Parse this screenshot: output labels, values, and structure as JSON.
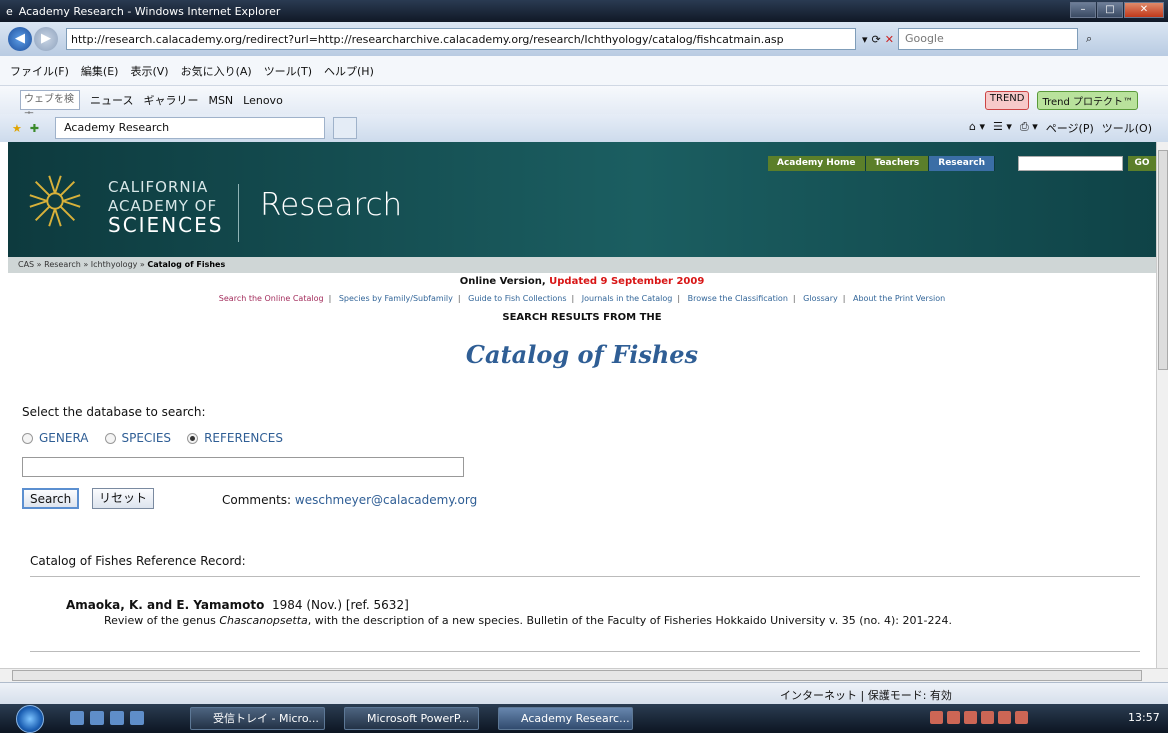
{
  "window": {
    "title": "Academy Research - Windows Internet Explorer"
  },
  "addressbar": {
    "url": "http://research.calacademy.org/redirect?url=http://researcharchive.calacademy.org/research/Ichthyology/catalog/fishcatmain.asp",
    "search_placeholder": "Google"
  },
  "menubar": {
    "items": [
      "ファイル(F)",
      "編集(E)",
      "表示(V)",
      "お気に入り(A)",
      "ツール(T)",
      "ヘルプ(H)"
    ]
  },
  "toolbar2": {
    "search_text": "ウェブを検索",
    "items": [
      "ニュース",
      "ギャラリー",
      "MSN",
      "Lenovo"
    ],
    "trend1": "TREND",
    "trend2": "Trend プロテクト™"
  },
  "tabbar": {
    "tab_label": "Academy Research",
    "page_menu": "ページ(P)",
    "tools_menu": "ツール(O)"
  },
  "header": {
    "logo": {
      "line1": "CALIFORNIA",
      "line2": "ACADEMY OF",
      "line3": "SCIENCES"
    },
    "title": "Research",
    "nav": [
      "Academy Home",
      "Teachers",
      "Research"
    ],
    "go_label": "GO"
  },
  "breadcrumb": {
    "prefix": "CAS » Research » Ichthyology » ",
    "current": "Catalog of Fishes"
  },
  "catalog": {
    "online_prefix": "Online Version, ",
    "updated": "Updated 9 September 2009",
    "links": [
      "Search the Online Catalog",
      "Species by Family/Subfamily",
      "Guide to Fish Collections",
      "Journals in the Catalog",
      "Browse the Classification",
      "Glossary",
      "About the Print Version"
    ],
    "results_heading": "SEARCH RESULTS FROM THE",
    "title": "Catalog of Fishes"
  },
  "form": {
    "db_label": "Select the database to search:",
    "options": [
      "GENERA",
      "SPECIES",
      "REFERENCES"
    ],
    "selected_option": "REFERENCES",
    "query_value": "",
    "search_label": "Search",
    "reset_label": "リセット",
    "comments_label": "Comments: ",
    "comments_email": "weschmeyer@calacademy.org"
  },
  "record": {
    "heading": "Catalog of Fishes Reference Record:",
    "authors": "Amaoka, K. and E. Yamamoto",
    "date_ref": "1984 (Nov.) [ref. 5632]",
    "title_start": "Review of the genus ",
    "genus": "Chascanopsetta",
    "title_end": ", with the description of a new species. Bulletin of the Faculty of Fisheries Hokkaido University v. 35 (no. 4): 201-224."
  },
  "statusbar": {
    "zone": "インターネット | 保護モード: 有効"
  },
  "taskbar": {
    "items": [
      "受信トレイ - Micro...",
      "Microsoft PowerP...",
      "Academy Researc..."
    ],
    "active_item": "Academy Researc...",
    "clock": "13:57"
  }
}
